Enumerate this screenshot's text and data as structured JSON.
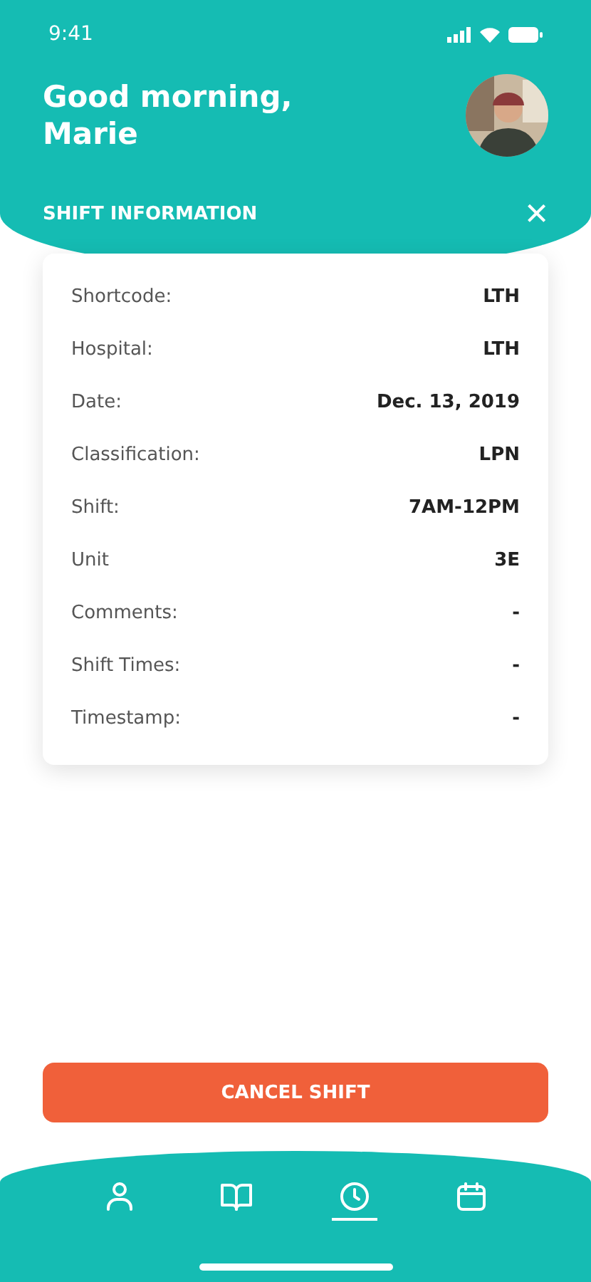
{
  "status_bar": {
    "time": "9:41"
  },
  "greeting": "Good morning,\nMarie",
  "section": {
    "title": "SHIFT INFORMATION",
    "close": "×"
  },
  "details": [
    {
      "label": "Shortcode:",
      "value": "LTH"
    },
    {
      "label": "Hospital:",
      "value": "LTH"
    },
    {
      "label": "Date:",
      "value": "Dec. 13, 2019"
    },
    {
      "label": "Classification:",
      "value": "LPN"
    },
    {
      "label": "Shift:",
      "value": "7AM-12PM"
    },
    {
      "label": "Unit",
      "value": "3E"
    },
    {
      "label": "Comments:",
      "value": "-"
    },
    {
      "label": "Shift Times:",
      "value": "-"
    },
    {
      "label": "Timestamp:",
      "value": "-"
    }
  ],
  "action": "CANCEL SHIFT",
  "nav": [
    {
      "kind": "profile",
      "selected": false
    },
    {
      "kind": "book",
      "selected": false
    },
    {
      "kind": "clock",
      "selected": true
    },
    {
      "kind": "calendar",
      "selected": false
    }
  ]
}
